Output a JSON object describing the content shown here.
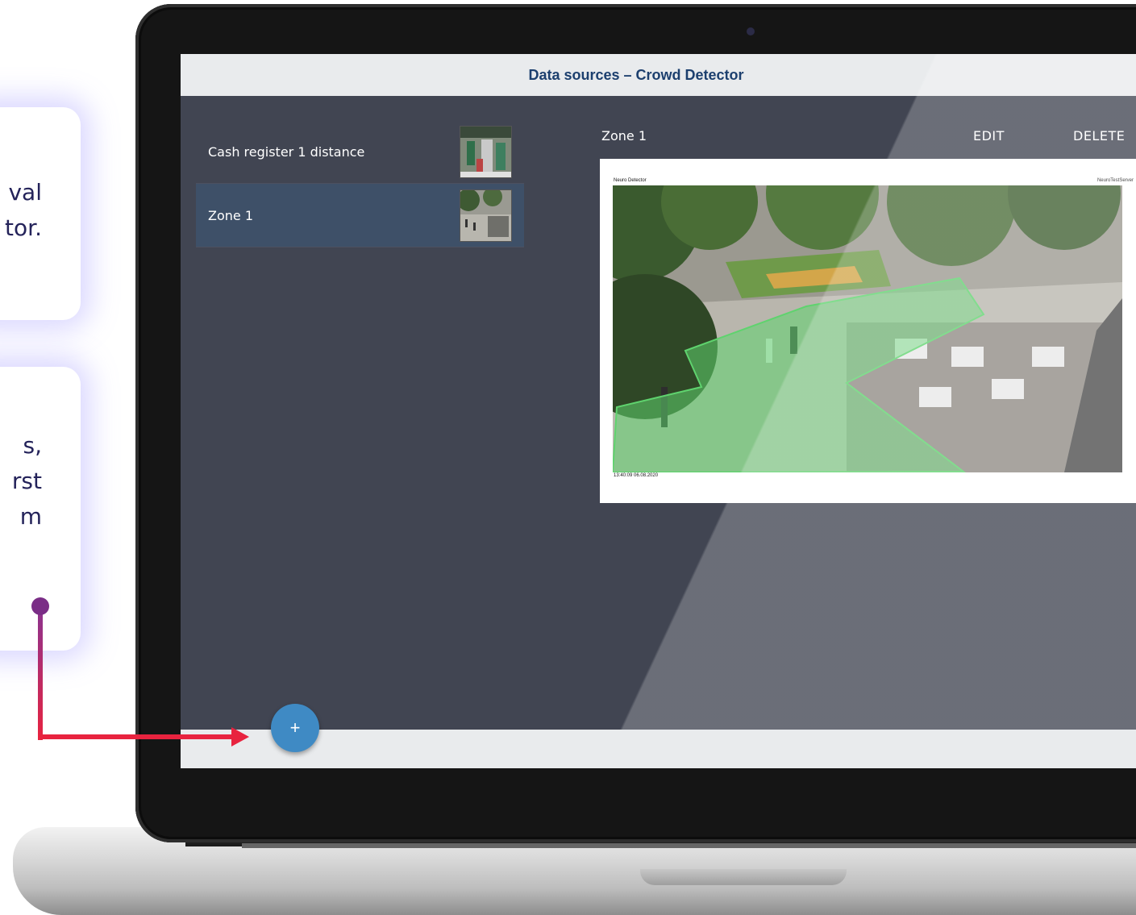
{
  "callouts": [
    {
      "lines": [
        "val",
        "tor."
      ]
    },
    {
      "lines": [
        "s,",
        "rst",
        "m"
      ]
    }
  ],
  "window": {
    "title": "Data sources – Crowd Detector"
  },
  "sources": [
    {
      "name": "Cash register 1 distance",
      "selected": false
    },
    {
      "name": "Zone 1",
      "selected": true
    }
  ],
  "detail": {
    "title": "Zone 1",
    "edit_label": "EDIT",
    "delete_label": "DELETE",
    "camera_label_left": "Neuro Detector",
    "camera_label_right": "NeuroTestServer",
    "timestamp": "13:40:09 06.08.2020"
  },
  "fab": {
    "label": "+"
  },
  "colors": {
    "accent": "#3f8ac4",
    "title": "#1c3f6e",
    "screen_bg": "#414552",
    "selected_row": "#3e5068",
    "arrow": "#e8233f",
    "zone_fill": "#5fd36e"
  },
  "icons": {
    "fab": "plus-icon"
  }
}
